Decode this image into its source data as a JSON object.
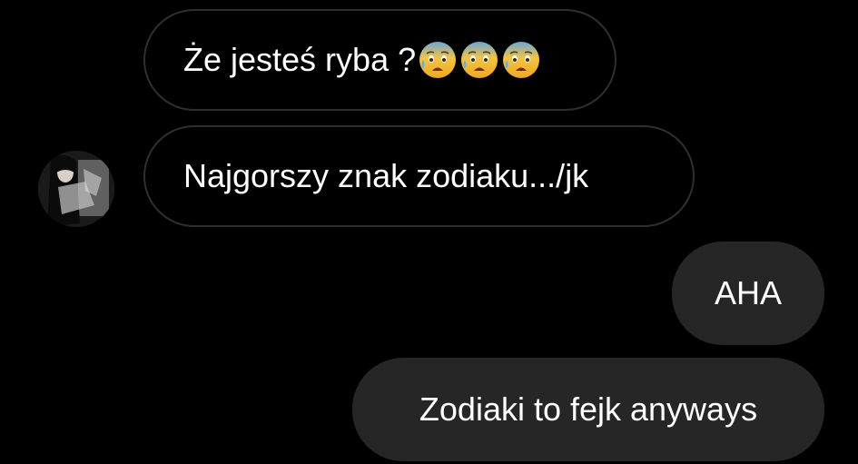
{
  "messages": [
    {
      "side": "incoming",
      "text": "Że jesteś ryba ?",
      "emoji": [
        "anxious-face-with-sweat",
        "anxious-face-with-sweat",
        "anxious-face-with-sweat"
      ]
    },
    {
      "side": "incoming",
      "text": "Najgorszy znak zodiaku.../jk",
      "avatar": "sender-avatar"
    },
    {
      "side": "outgoing",
      "text": "AHA"
    },
    {
      "side": "outgoing",
      "text": "Zodiaki to fejk anyways"
    }
  ],
  "colors": {
    "background": "#000000",
    "incoming_border": "#2f2f2f",
    "outgoing_bubble": "#262626",
    "text": "#ffffff"
  }
}
